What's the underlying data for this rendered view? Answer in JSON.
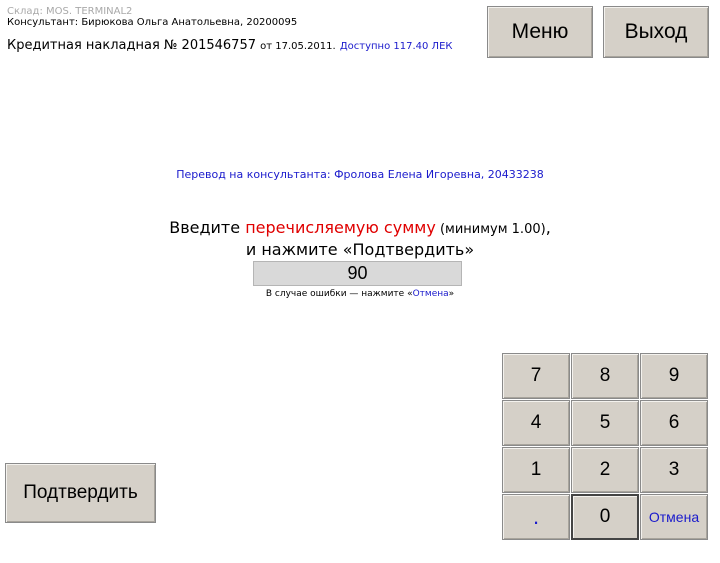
{
  "header": {
    "warehouse": "Склад: MOS. TERMINAL2",
    "consultant": "Консультант: Бирюкова Ольга Анатольевна, 20200095",
    "invoice_title": "Кредитная накладная № 201546757",
    "invoice_date": "от 17.05.2011.",
    "available": "Доступно 117.40 ЛЕК"
  },
  "top_buttons": {
    "menu": "Меню",
    "exit": "Выход"
  },
  "transfer": "Перевод на консультанта: Фролова Елена Игоревна, 20433238",
  "prompt": {
    "part1": "Введите ",
    "highlight": "перечисляемую сумму",
    "minimum": " (минимум 1.00)",
    "tail": ",",
    "line2": "и нажмите «Подтвердить»"
  },
  "amount_value": "90",
  "error_hint": {
    "before": "В случае ошибки — нажмите «",
    "link": "Отмена",
    "after": "»"
  },
  "keypad": {
    "k7": "7",
    "k8": "8",
    "k9": "9",
    "k4": "4",
    "k5": "5",
    "k6": "6",
    "k1": "1",
    "k2": "2",
    "k3": "3",
    "dot": ".",
    "k0": "0",
    "cancel": "Отмена"
  },
  "confirm": "Подтвердить"
}
